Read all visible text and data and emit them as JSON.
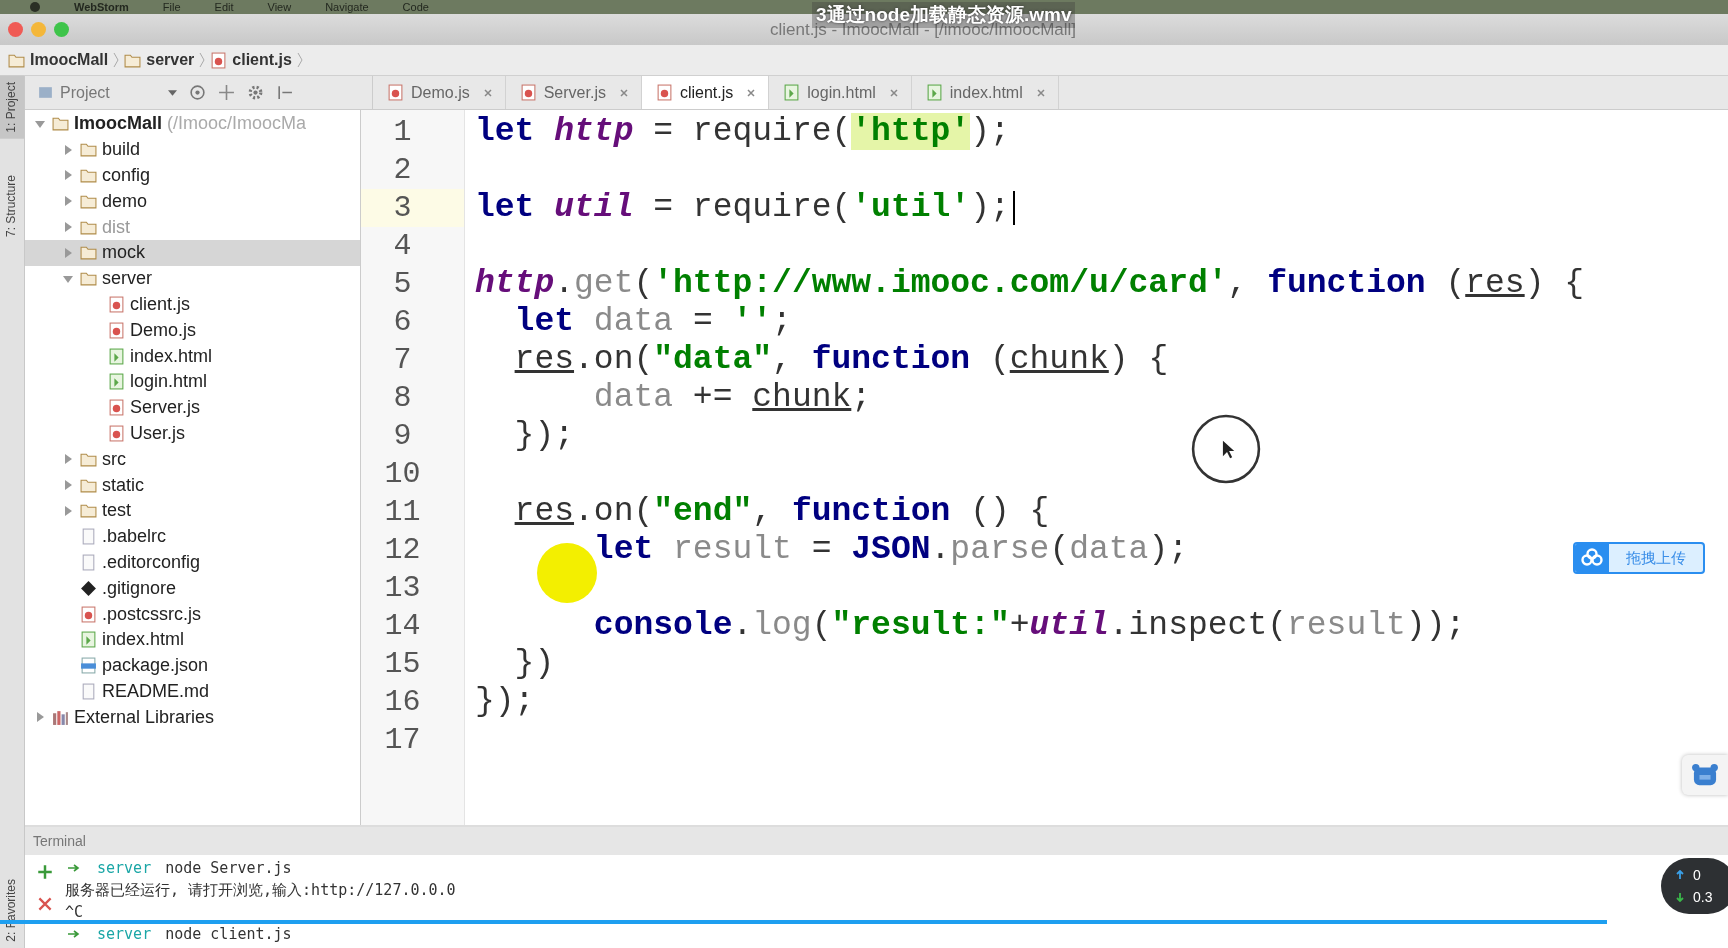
{
  "player": {
    "title": "3通过node加载静态资源.wmv",
    "progress": {
      "level": 0.93
    }
  },
  "menu_bar": [
    "WebStorm",
    "File",
    "Edit",
    "View",
    "Navigate",
    "Code"
  ],
  "window": {
    "title": "client.js - ImoocMall - [/imooc/ImoocMall]"
  },
  "breadcrumbs": [
    {
      "label": "ImoocMall",
      "kind": "folder"
    },
    {
      "label": "server",
      "kind": "folder"
    },
    {
      "label": "client.js",
      "kind": "js"
    }
  ],
  "tool_strip": {
    "top": [
      {
        "label": "1: Project",
        "selected": true
      },
      {
        "label": "7: Structure",
        "selected": false
      }
    ],
    "bottom": [
      {
        "label": "2: Favorites",
        "selected": false
      }
    ]
  },
  "project_panel": {
    "label": "Project"
  },
  "tabs": [
    {
      "label": "Demo.js",
      "kind": "js",
      "selected": false
    },
    {
      "label": "Server.js",
      "kind": "js",
      "selected": false
    },
    {
      "label": "client.js",
      "kind": "js",
      "selected": true
    },
    {
      "label": "login.html",
      "kind": "html",
      "selected": false
    },
    {
      "label": "index.html",
      "kind": "html",
      "selected": false
    }
  ],
  "tree": [
    {
      "label": "ImoocMall",
      "path": "(/Imooc/ImoocMa",
      "kind": "folder",
      "expanded": true,
      "excluded": false,
      "selected": false,
      "children": [
        {
          "label": "build",
          "kind": "folder",
          "expanded": false,
          "excluded": false,
          "selected": false
        },
        {
          "label": "config",
          "kind": "folder",
          "expanded": false,
          "excluded": false,
          "selected": false
        },
        {
          "label": "demo",
          "kind": "folder",
          "expanded": false,
          "excluded": false,
          "selected": false
        },
        {
          "label": "dist",
          "kind": "folder",
          "expanded": false,
          "excluded": true,
          "selected": false
        },
        {
          "label": "mock",
          "kind": "folder",
          "expanded": false,
          "excluded": false,
          "selected": true
        },
        {
          "label": "server",
          "kind": "folder",
          "expanded": true,
          "excluded": false,
          "selected": false,
          "children": [
            {
              "label": "client.js",
              "kind": "js",
              "selected": false
            },
            {
              "label": "Demo.js",
              "kind": "js",
              "selected": false
            },
            {
              "label": "index.html",
              "kind": "html",
              "selected": false
            },
            {
              "label": "login.html",
              "kind": "html",
              "selected": false
            },
            {
              "label": "Server.js",
              "kind": "js",
              "selected": false
            },
            {
              "label": "User.js",
              "kind": "js",
              "selected": false
            }
          ]
        },
        {
          "label": "src",
          "kind": "folder",
          "expanded": false,
          "excluded": false,
          "selected": false
        },
        {
          "label": "static",
          "kind": "folder",
          "expanded": false,
          "excluded": false,
          "selected": false
        },
        {
          "label": "test",
          "kind": "folder",
          "expanded": false,
          "excluded": false,
          "selected": false
        },
        {
          "label": ".babelrc",
          "kind": "file",
          "selected": false
        },
        {
          "label": ".editorconfig",
          "kind": "file",
          "selected": false
        },
        {
          "label": ".gitignore",
          "kind": "git",
          "selected": false
        },
        {
          "label": ".postcssrc.js",
          "kind": "js",
          "selected": false
        },
        {
          "label": "index.html",
          "kind": "html",
          "selected": false
        },
        {
          "label": "package.json",
          "kind": "json",
          "selected": false
        },
        {
          "label": "README.md",
          "kind": "file",
          "selected": false
        }
      ]
    },
    {
      "label": "External Libraries",
      "kind": "lib",
      "expanded": false,
      "excluded": false,
      "selected": false
    }
  ],
  "editor": {
    "lines": [
      {
        "number": "1",
        "current": false,
        "tokens": [
          {
            "t": "let",
            "kind": "kw"
          },
          {
            "t": " http",
            "kind": "var"
          },
          {
            "t": " = require(",
            "kind": "plain"
          },
          {
            "t": "'http'",
            "kind": "match"
          },
          {
            "t": ");",
            "kind": "plain"
          }
        ]
      },
      {
        "number": "2",
        "current": false
      },
      {
        "number": "3",
        "current": true,
        "tokens": [
          {
            "t": "let",
            "kind": "kw"
          },
          {
            "t": " util",
            "kind": "var"
          },
          {
            "t": " = require(",
            "kind": "plain"
          },
          {
            "t": "'util'",
            "kind": "str"
          },
          {
            "t": ");",
            "kind": "plain"
          }
        ]
      },
      {
        "number": "4",
        "current": false
      },
      {
        "number": "5",
        "current": false,
        "tokens": [
          {
            "t": "http",
            "kind": "var"
          },
          {
            "t": ".",
            "kind": "plain"
          },
          {
            "t": "get",
            "kind": "dim"
          },
          {
            "t": "(",
            "kind": "plain"
          },
          {
            "t": "'http://www.imooc.com/u/card'",
            "kind": "str"
          },
          {
            "t": ", ",
            "kind": "plain"
          },
          {
            "t": "function",
            "kind": "kw"
          },
          {
            "t": " (",
            "kind": "plain"
          },
          {
            "t": "res",
            "kind": "param"
          },
          {
            "t": ") {",
            "kind": "plain"
          }
        ]
      },
      {
        "number": "6",
        "current": false,
        "tokens": [
          {
            "t": "  let",
            "kind": "kw"
          },
          {
            "t": " data",
            "kind": "dim"
          },
          {
            "t": " = ",
            "kind": "plain"
          },
          {
            "t": "''",
            "kind": "str"
          },
          {
            "t": ";",
            "kind": "plain"
          }
        ]
      },
      {
        "number": "7",
        "current": false,
        "tokens": [
          {
            "t": "  res",
            "kind": "param"
          },
          {
            "t": ".on(",
            "kind": "plain"
          },
          {
            "t": "\"data\"",
            "kind": "str"
          },
          {
            "t": ", ",
            "kind": "plain"
          },
          {
            "t": "function",
            "kind": "kw"
          },
          {
            "t": " (",
            "kind": "plain"
          },
          {
            "t": "chunk",
            "kind": "param"
          },
          {
            "t": ") {",
            "kind": "plain"
          }
        ]
      },
      {
        "number": "8",
        "current": false,
        "tokens": [
          {
            "t": "      data",
            "kind": "dim"
          },
          {
            "t": " += ",
            "kind": "plain"
          },
          {
            "t": "chunk",
            "kind": "param"
          },
          {
            "t": ";",
            "kind": "plain"
          }
        ]
      },
      {
        "number": "9",
        "current": false,
        "tokens": [
          {
            "t": "  });",
            "kind": "plain"
          }
        ]
      },
      {
        "number": "10",
        "current": false
      },
      {
        "number": "11",
        "current": false,
        "tokens": [
          {
            "t": "  res",
            "kind": "param"
          },
          {
            "t": ".on(",
            "kind": "plain"
          },
          {
            "t": "\"end\"",
            "kind": "str"
          },
          {
            "t": ", ",
            "kind": "plain"
          },
          {
            "t": "function",
            "kind": "kw"
          },
          {
            "t": " () {",
            "kind": "plain"
          }
        ]
      },
      {
        "number": "12",
        "current": false,
        "tokens": [
          {
            "t": "      let",
            "kind": "kw"
          },
          {
            "t": " result",
            "kind": "dim"
          },
          {
            "t": " = ",
            "kind": "plain"
          },
          {
            "t": "JSON",
            "kind": "kw"
          },
          {
            "t": ".",
            "kind": "plain"
          },
          {
            "t": "parse",
            "kind": "dim"
          },
          {
            "t": "(",
            "kind": "plain"
          },
          {
            "t": "data",
            "kind": "dim"
          },
          {
            "t": ");",
            "kind": "plain"
          }
        ]
      },
      {
        "number": "13",
        "current": false
      },
      {
        "number": "14",
        "current": false,
        "tokens": [
          {
            "t": "      console",
            "kind": "kw"
          },
          {
            "t": ".",
            "kind": "plain"
          },
          {
            "t": "log",
            "kind": "dim"
          },
          {
            "t": "(",
            "kind": "plain"
          },
          {
            "t": "\"result:\"",
            "kind": "str"
          },
          {
            "t": "+",
            "kind": "plain"
          },
          {
            "t": "util",
            "kind": "var"
          },
          {
            "t": ".inspect(",
            "kind": "plain"
          },
          {
            "t": "result",
            "kind": "dim"
          },
          {
            "t": "));",
            "kind": "plain"
          }
        ]
      },
      {
        "number": "15",
        "current": false,
        "tokens": [
          {
            "t": "  })",
            "kind": "plain"
          }
        ]
      },
      {
        "number": "16",
        "current": false,
        "tokens": [
          {
            "t": "});",
            "kind": "plain"
          }
        ]
      },
      {
        "number": "17",
        "current": false
      }
    ]
  },
  "terminal": {
    "title": "Terminal",
    "lines": [
      {
        "kind": "prompt",
        "dir": "server",
        "text": "node Server.js"
      },
      {
        "kind": "output",
        "text": "服务器已经运行, 请打开浏览,输入:http://127.0.0.0"
      },
      {
        "kind": "output",
        "text": "^C"
      },
      {
        "kind": "prompt",
        "dir": "server",
        "text": "node client.js"
      }
    ]
  },
  "overlays": {
    "upload_button": "拖拽上传",
    "speed": [
      "0",
      "0.3"
    ]
  }
}
